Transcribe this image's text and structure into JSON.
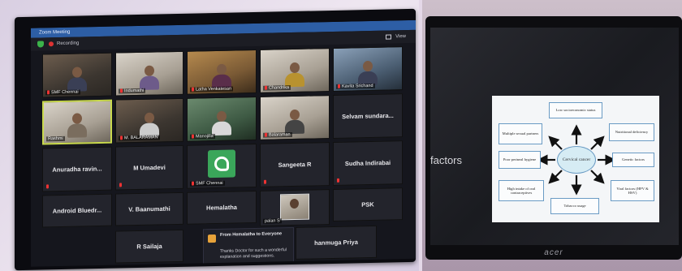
{
  "zoom": {
    "window_title": "Zoom Meeting",
    "recording_label": "Recording",
    "view_label": "View",
    "participants_video": [
      {
        "name": "SMF Chennai"
      },
      {
        "name": "Indumathi"
      },
      {
        "name": "Latha Venkatesan"
      },
      {
        "name": "Chandrika"
      },
      {
        "name": "Kavita Srichand"
      },
      {
        "name": "Rashmi"
      },
      {
        "name": "M. BALARAMAN"
      },
      {
        "name": "Manojilla"
      },
      {
        "name": "Balaraman"
      }
    ],
    "participants_text": [
      {
        "name": "Selvam sundara..."
      },
      {
        "name": "Anuradha ravin..."
      },
      {
        "name": "M Umadevi"
      },
      {
        "name": "Sangeeta R"
      },
      {
        "name": "Sudha Indirabai"
      },
      {
        "name": "Android Bluedr..."
      },
      {
        "name": "V. Baanumathi"
      },
      {
        "name": "Hemalatha"
      },
      {
        "name": "PSK"
      },
      {
        "name": "R Sailaja"
      },
      {
        "name": "hanmuga Priya"
      }
    ],
    "smf_tile_label": "SMF Chennai",
    "photo_tile_label": "palan S",
    "chat": {
      "header": "From Hemalatha to Everyone",
      "message": "Thanks Doctor for such a wonderful explanation and suggestions."
    }
  },
  "laptop": {
    "brand": "acer",
    "side_text": "factors",
    "slide": {
      "center": "Cervical cancer",
      "boxes": [
        "Low socioeconomic status",
        "Multiple sexual partners",
        "Nutritional deficiency",
        "Poor perineal hygiene",
        "Genetic factors",
        "High intake of oral contraceptives",
        "Viral factors (HPV & HSV)",
        "Tobacco usage"
      ]
    }
  }
}
